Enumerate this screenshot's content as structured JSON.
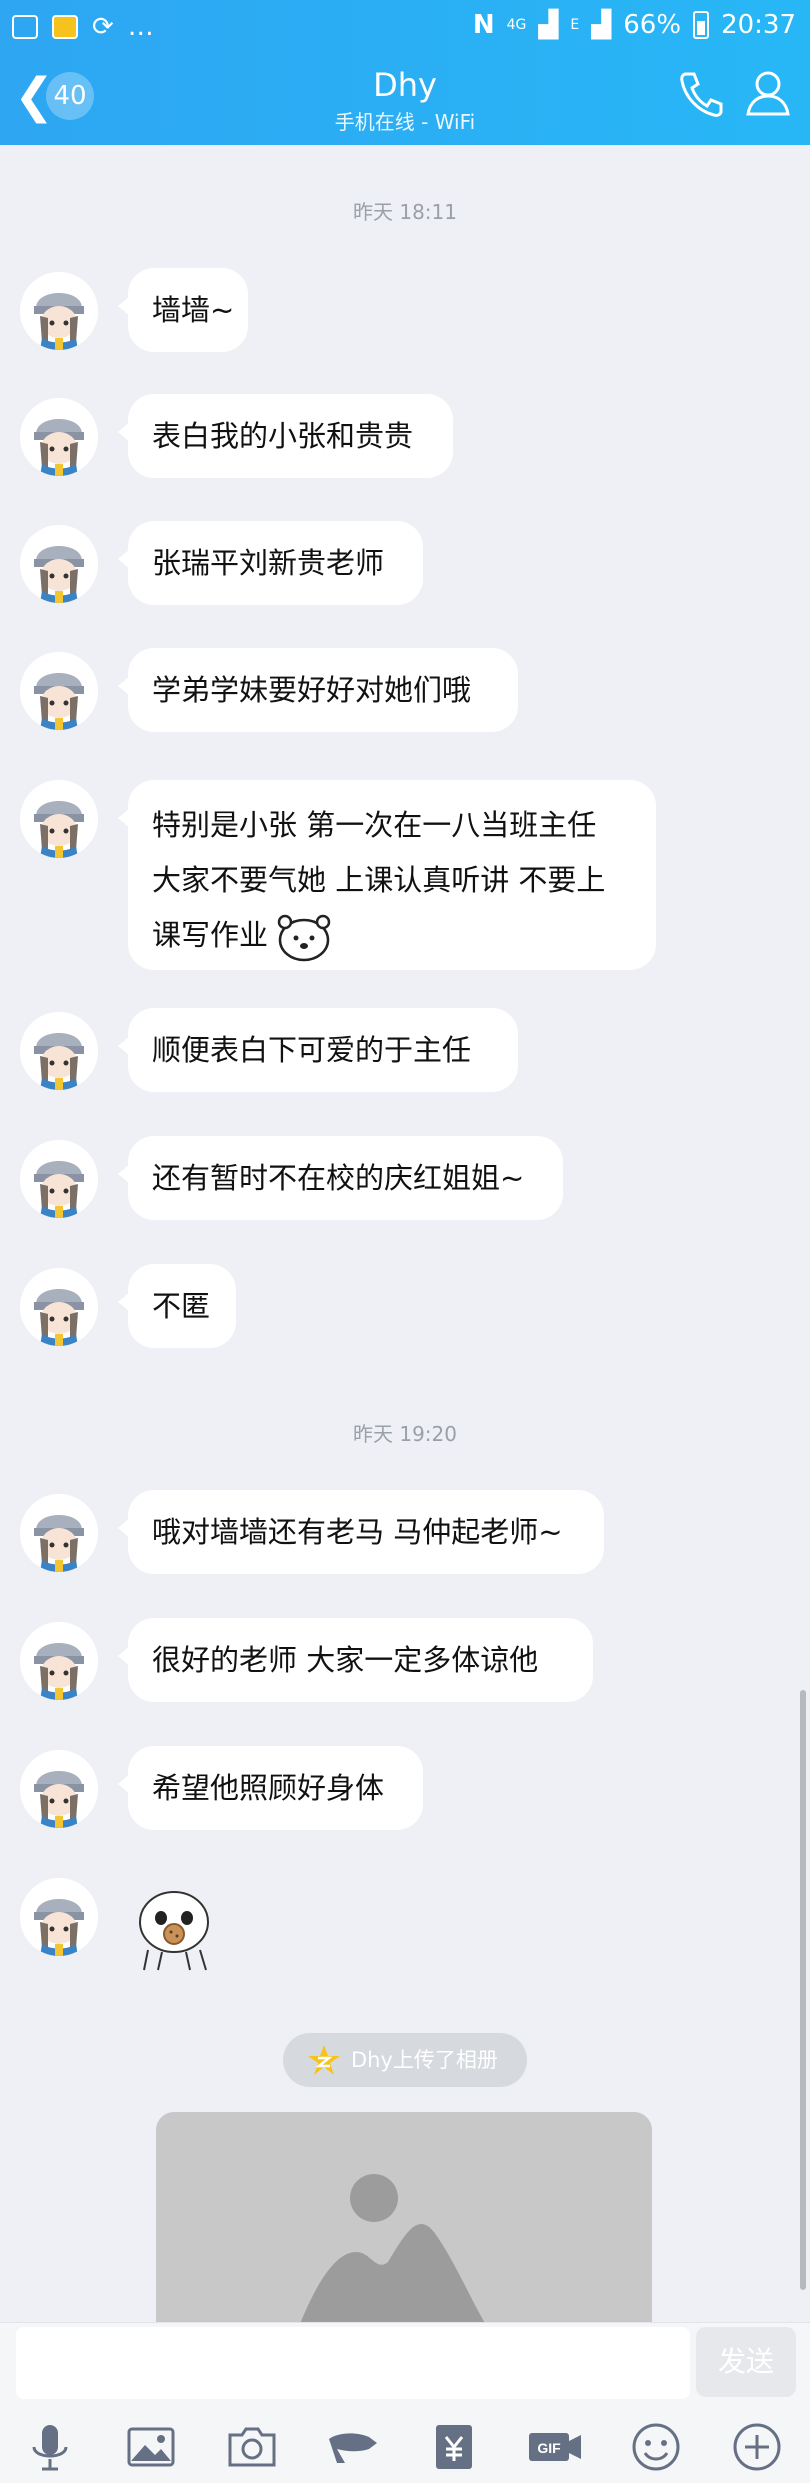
{
  "status": {
    "battery": "66%",
    "time": "20:37",
    "net": "4G",
    "net2": "E"
  },
  "header": {
    "unread": "40",
    "title": "Dhy",
    "subtitle": "手机在线 - WiFi"
  },
  "timestamps": [
    "昨天 18:11",
    "昨天 19:20"
  ],
  "messages": [
    "墙墙~",
    "表白我的小张和贵贵",
    "张瑞平刘新贵老师",
    "学弟学妹要好好对她们哦",
    "特别是小张 第一次在一八当班主任 大家不要气她 上课认真听讲 不要上课写作业",
    "顺便表白下可爱的于主任",
    "还有暂时不在校的庆红姐姐~",
    "不匿",
    "哦对墙墙还有老马 马仲起老师~",
    "很好的老师 大家一定多体谅他",
    "希望他照顾好身体"
  ],
  "notice": "Dhy上传了相册",
  "input": {
    "placeholder": "",
    "send_label": "发送"
  },
  "toolbar": [
    "mic-icon",
    "image-icon",
    "camera-icon",
    "redpacket-icon",
    "yuan-icon",
    "gif-icon",
    "emoji-icon",
    "plus-icon"
  ],
  "colors": {
    "header": "#2ea6f2",
    "background": "#eef0f5",
    "bubble": "#ffffff"
  }
}
